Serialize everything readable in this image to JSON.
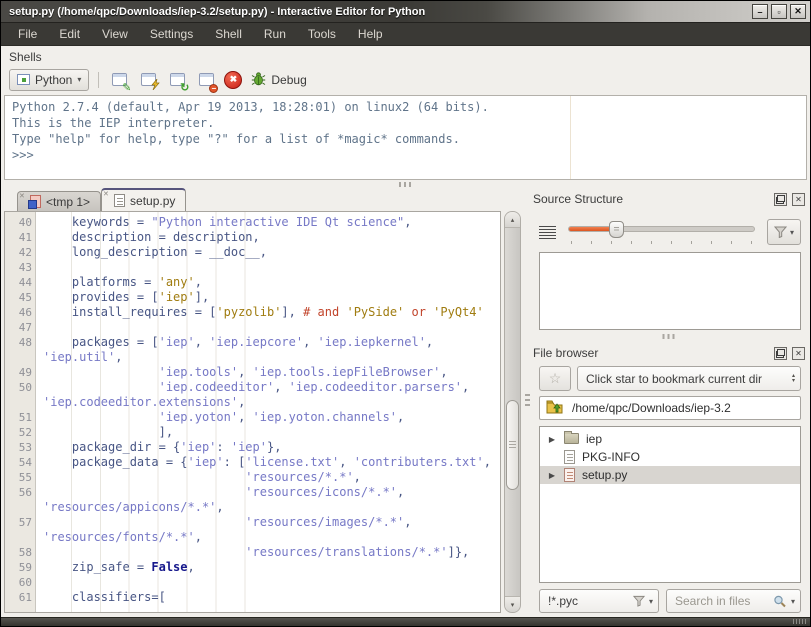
{
  "window": {
    "title": "setup.py (/home/qpc/Downloads/iep-3.2/setup.py) - Interactive Editor for Python"
  },
  "icons": {
    "chevron_down": "▾",
    "minimize": "–",
    "maximize": "▫",
    "close": "✕",
    "star": "☆",
    "expander": "▶",
    "scroll_up": "▴",
    "scroll_down": "▾",
    "spin_up": "▴",
    "spin_down": "▾",
    "tab_close": "✕",
    "panel_close": "✕",
    "stop_cross": "✖",
    "restart": "↻",
    "pencil": "✎",
    "terminate_minus": "−"
  },
  "colors": {
    "accent_orange": "#dd5420",
    "menubar_bg": "#3a3935",
    "panel_bg": "#f1efeb",
    "code_plain": "#475584",
    "code_string_amber": "#a07c10",
    "code_string_lavender": "#7678c6",
    "code_comment": "#c2452c",
    "code_keyword": "#16188c",
    "shell_text": "#60748a"
  },
  "menu": {
    "items": [
      "File",
      "Edit",
      "View",
      "Settings",
      "Shell",
      "Run",
      "Tools",
      "Help"
    ]
  },
  "shells": {
    "label": "Shells",
    "toolbar": {
      "python_label": "Python",
      "debug_label": "Debug"
    },
    "output_lines": [
      "Python 2.7.4 (default, Apr 19 2013, 18:28:01) on linux2 (64 bits).",
      "This is the IEP interpreter.",
      "Type \"help\" for help, type \"?\" for a list of *magic* commands.",
      ">>>"
    ]
  },
  "editor": {
    "tabs": [
      {
        "label": "<tmp 1>",
        "active": false
      },
      {
        "label": "setup.py",
        "active": true
      }
    ],
    "rows": [
      {
        "n": "40",
        "seg": [
          [
            "p",
            "    keywords = "
          ],
          [
            "s2",
            "\"Python interactive IDE Qt science\""
          ],
          [
            "p",
            ","
          ]
        ]
      },
      {
        "n": "41",
        "seg": [
          [
            "p",
            "    description = description,"
          ]
        ]
      },
      {
        "n": "42",
        "seg": [
          [
            "p",
            "    long_description = __doc__,"
          ]
        ]
      },
      {
        "n": "43",
        "seg": []
      },
      {
        "n": "44",
        "seg": [
          [
            "p",
            "    platforms = "
          ],
          [
            "s1",
            "'any'"
          ],
          [
            "p",
            ","
          ]
        ]
      },
      {
        "n": "45",
        "seg": [
          [
            "p",
            "    provides = ["
          ],
          [
            "s1",
            "'iep'"
          ],
          [
            "p",
            "],"
          ]
        ]
      },
      {
        "n": "46",
        "seg": [
          [
            "p",
            "    install_requires = ["
          ],
          [
            "s1",
            "'pyzolib'"
          ],
          [
            "p",
            "], "
          ],
          [
            "c",
            "# and "
          ],
          [
            "s1",
            "'PySide'"
          ],
          [
            "c",
            " or "
          ],
          [
            "s1",
            "'PyQt4'"
          ]
        ]
      },
      {
        "n": "47",
        "seg": []
      },
      {
        "n": "48",
        "seg": [
          [
            "p",
            "    packages = ["
          ],
          [
            "s2",
            "'iep'"
          ],
          [
            "p",
            ", "
          ],
          [
            "s2",
            "'iep.iepcore'"
          ],
          [
            "p",
            ", "
          ],
          [
            "s2",
            "'iep.iepkernel'"
          ],
          [
            "p",
            ","
          ]
        ]
      },
      {
        "n": "",
        "seg": [
          [
            "s2",
            "'iep.util'"
          ],
          [
            "p",
            ","
          ]
        ]
      },
      {
        "n": "49",
        "seg": [
          [
            "p",
            "                "
          ],
          [
            "s2",
            "'iep.tools'"
          ],
          [
            "p",
            ", "
          ],
          [
            "s2",
            "'iep.tools.iepFileBrowser'"
          ],
          [
            "p",
            ","
          ]
        ]
      },
      {
        "n": "50",
        "seg": [
          [
            "p",
            "                "
          ],
          [
            "s2",
            "'iep.codeeditor'"
          ],
          [
            "p",
            ", "
          ],
          [
            "s2",
            "'iep.codeeditor.parsers'"
          ],
          [
            "p",
            ","
          ]
        ]
      },
      {
        "n": "",
        "seg": [
          [
            "s2",
            "'iep.codeeditor.extensions'"
          ],
          [
            "p",
            ","
          ]
        ]
      },
      {
        "n": "51",
        "seg": [
          [
            "p",
            "                "
          ],
          [
            "s2",
            "'iep.yoton'"
          ],
          [
            "p",
            ", "
          ],
          [
            "s2",
            "'iep.yoton.channels'"
          ],
          [
            "p",
            ","
          ]
        ]
      },
      {
        "n": "52",
        "seg": [
          [
            "p",
            "                ],"
          ]
        ]
      },
      {
        "n": "53",
        "seg": [
          [
            "p",
            "    package_dir = {"
          ],
          [
            "s2",
            "'iep'"
          ],
          [
            "p",
            ": "
          ],
          [
            "s2",
            "'iep'"
          ],
          [
            "p",
            "},"
          ]
        ]
      },
      {
        "n": "54",
        "seg": [
          [
            "p",
            "    package_data = {"
          ],
          [
            "s2",
            "'iep'"
          ],
          [
            "p",
            ": ["
          ],
          [
            "s2",
            "'license.txt'"
          ],
          [
            "p",
            ", "
          ],
          [
            "s2",
            "'contributers.txt'"
          ],
          [
            "p",
            ","
          ]
        ]
      },
      {
        "n": "55",
        "seg": [
          [
            "p",
            "                            "
          ],
          [
            "s2",
            "'resources/*.*'"
          ],
          [
            "p",
            ","
          ]
        ]
      },
      {
        "n": "56",
        "seg": [
          [
            "p",
            "                            "
          ],
          [
            "s2",
            "'resources/icons/*.*'"
          ],
          [
            "p",
            ","
          ]
        ]
      },
      {
        "n": "",
        "seg": [
          [
            "s2",
            "'resources/appicons/*.*'"
          ],
          [
            "p",
            ","
          ]
        ]
      },
      {
        "n": "57",
        "seg": [
          [
            "p",
            "                            "
          ],
          [
            "s2",
            "'resources/images/*.*'"
          ],
          [
            "p",
            ","
          ]
        ]
      },
      {
        "n": "",
        "seg": [
          [
            "s2",
            "'resources/fonts/*.*'"
          ],
          [
            "p",
            ","
          ]
        ]
      },
      {
        "n": "58",
        "seg": [
          [
            "p",
            "                            "
          ],
          [
            "s2",
            "'resources/translations/*.*'"
          ],
          [
            "p",
            "]},"
          ]
        ]
      },
      {
        "n": "59",
        "seg": [
          [
            "p",
            "    zip_safe = "
          ],
          [
            "k",
            "False"
          ],
          [
            "p",
            ","
          ]
        ]
      },
      {
        "n": "60",
        "seg": []
      },
      {
        "n": "61",
        "seg": [
          [
            "p",
            "    classifiers=["
          ]
        ]
      }
    ]
  },
  "source_structure": {
    "title": "Source Structure",
    "slider": {
      "value_fraction": 0.26,
      "ticks": 10
    }
  },
  "file_browser": {
    "title": "File browser",
    "bookmark_placeholder": "Click star to bookmark current dir",
    "path": "/home/qpc/Downloads/iep-3.2",
    "tree": [
      {
        "name": "iep",
        "type": "folder",
        "expandable": true,
        "selected": false
      },
      {
        "name": "PKG-INFO",
        "type": "file",
        "expandable": false,
        "selected": false
      },
      {
        "name": "setup.py",
        "type": "python",
        "expandable": true,
        "selected": true
      }
    ],
    "filter_value": "!*.pyc",
    "search_placeholder": "Search in files"
  }
}
